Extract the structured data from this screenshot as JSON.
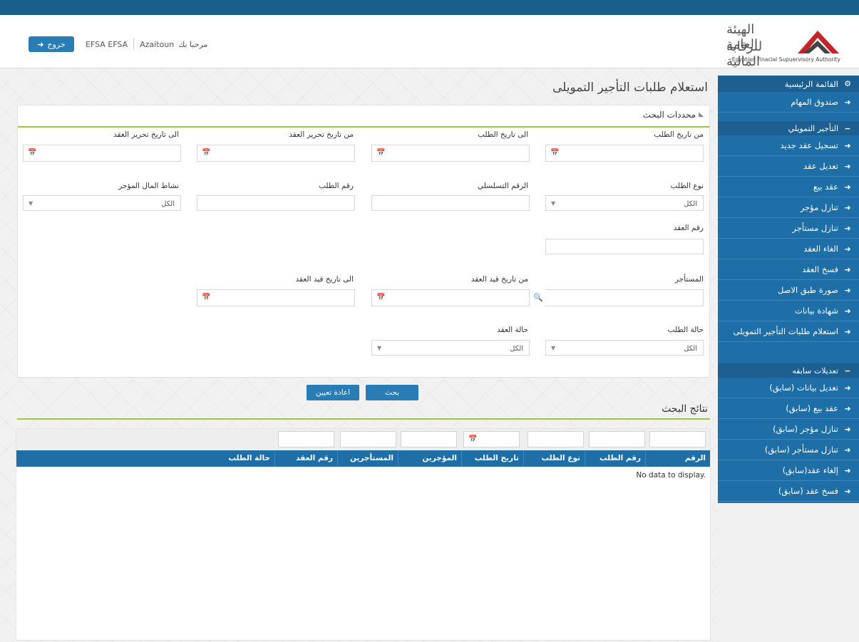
{
  "header": {
    "logout_label": "خروج",
    "username": "EFSA EFSA",
    "greeting": "مرحبا بك",
    "user_short": "Azaitoun",
    "logo_ar_line1": "الهيئة العامة",
    "logo_ar_line2": "للرقابة المالية",
    "logo_en": "Egyptian Finacial Supuervisory Authority"
  },
  "sidebar": {
    "main_menu": "القائمة الرئيسية",
    "tasks": "صندوق المهام",
    "section1": "التأجير التمويلي",
    "section1_items": [
      "تسجيل عقد جديد",
      "تعديل عقد",
      "عقد بيع",
      "تنازل مؤجر",
      "تنازل مستأجر",
      "الغاء العقد",
      "فسخ العقد",
      "صورة طبق الاصل",
      "شهادة بيانات",
      "استعلام طلبات التأجير التمويلى"
    ],
    "section2": "تعديلات سابقه",
    "section2_items": [
      "تعديل بيانات (سابق)",
      "عقد بيع (سابق)",
      "تنازل مؤجر (سابق)",
      "تنازل مستأجر (سابق)",
      "إلغاء عقد(سابق)",
      "فسخ عقد (سابق)"
    ]
  },
  "page": {
    "title": "استعلام طلبات التأجير التمويلى"
  },
  "search": {
    "panel_title": "محددات البحث",
    "from_request_date": "من تاريخ الطلب",
    "to_request_date": "الى تاريخ الطلب",
    "from_contract_write_date": "من تاريخ تحرير العقد",
    "to_contract_write_date": "الى تاريخ تحرير العقد",
    "request_type": "نوع الطلب",
    "serial_number": "الرقم التسلسلي",
    "request_number": "رقم الطلب",
    "leased_asset_activity": "نشاط المال المؤجر",
    "contract_number": "رقم العقد",
    "lessee": "المستأجر",
    "from_contract_reg_date": "من تاريخ قيد العقد",
    "to_contract_reg_date": "الى تاريخ قيد العقد",
    "request_status": "حالة الطلب",
    "contract_status": "حالة العقد",
    "select_all": "الكل",
    "search_button": "بحث",
    "reset_button": "اعادة تعيين"
  },
  "results": {
    "title": "نتائج البحث",
    "columns": [
      "الرقم التسلسلي",
      "رقم الطلب",
      "نوع الطلب",
      "تاريخ الطلب",
      "المؤجرين",
      "المستأجرين",
      "رقم العقد",
      "حالة الطلب"
    ],
    "empty_text": "No data to display."
  },
  "colors": {
    "top_bar": "#1a5f8c",
    "sidebar": "#1e6fa8",
    "accent_line": "#9cc63c",
    "button": "#2a7cb5"
  }
}
